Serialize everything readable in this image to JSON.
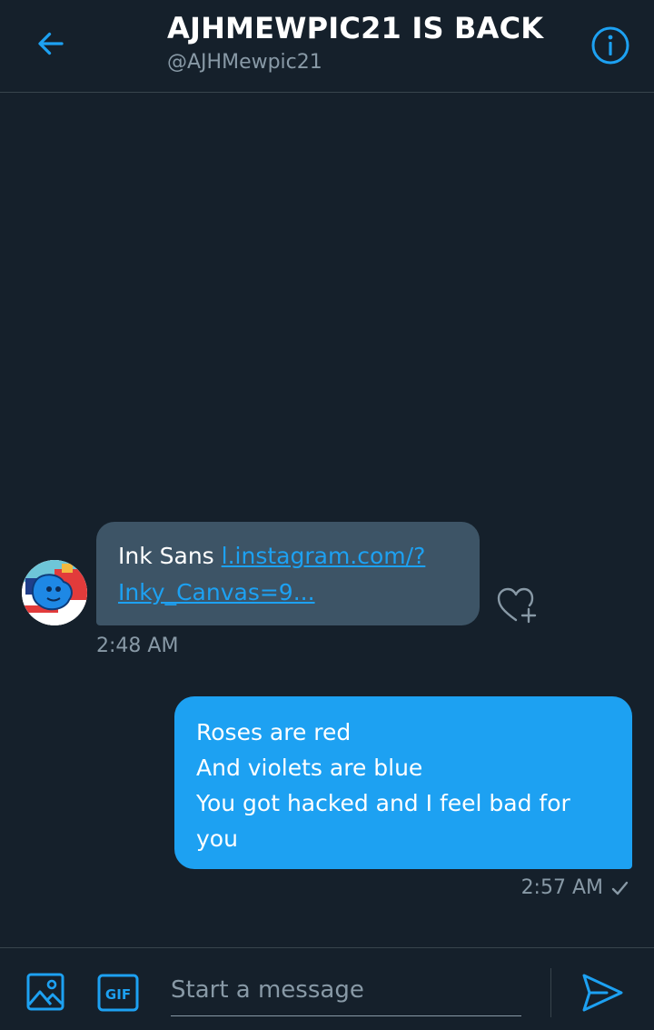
{
  "header": {
    "title": "AJHMEWPIC21 IS BACK",
    "handle": "@AJHMewpic21",
    "back_icon": "arrow-left-icon",
    "info_icon": "info-icon"
  },
  "conversation": {
    "received": {
      "text": "Ink Sans ",
      "link_line1": "l.instagram.com/?",
      "link_line2": "Inky_Canvas=9...",
      "time": "2:48 AM",
      "like_icon": "heart-plus-icon"
    },
    "sent": {
      "lines": [
        "Roses are red",
        "And violets are blue",
        "You got hacked and I feel bad for",
        "you"
      ],
      "time": "2:57 AM",
      "status_icon": "checkmark-icon"
    }
  },
  "composer": {
    "placeholder": "Start a message",
    "value": "",
    "gif_label": "GIF",
    "media_icon": "image-icon",
    "send_icon": "send-icon"
  },
  "colors": {
    "background": "#15202b",
    "accent": "#1da1f2",
    "received_bubble": "#3d5466",
    "muted_text": "#8899a6",
    "divider": "#38444d"
  }
}
